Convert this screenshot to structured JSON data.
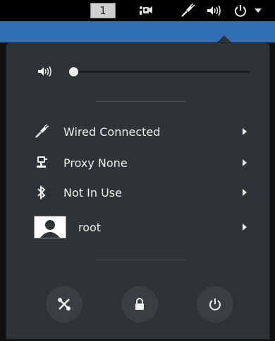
{
  "topbar": {
    "workspace_number": "1",
    "icons": [
      "accessibility-icon",
      "network-wired-icon",
      "volume-icon",
      "power-icon",
      "dropdown-arrow-icon"
    ]
  },
  "volume": {
    "level": 0.0,
    "icon": "volume-icon"
  },
  "items": [
    {
      "icon": "network-wired-icon",
      "label": "Wired Connected"
    },
    {
      "icon": "proxy-icon",
      "label": "Proxy None"
    },
    {
      "icon": "bluetooth-icon",
      "label": "Not In Use"
    },
    {
      "icon": "user-avatar",
      "label": "root"
    }
  ],
  "actions": [
    "settings-icon",
    "lock-icon",
    "power-off-icon"
  ],
  "colors": {
    "panel": "#2e3436",
    "topbar": "#000000",
    "text": "#eeeeec",
    "wallpaper": "#2f6fb4"
  }
}
